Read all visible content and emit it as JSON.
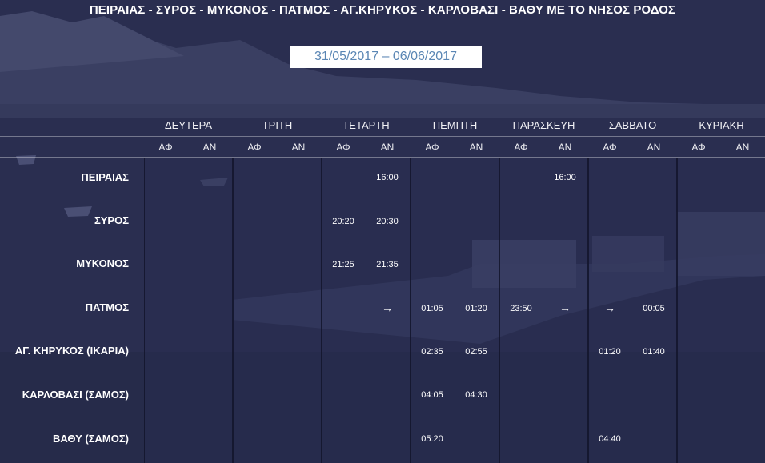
{
  "header": {
    "title": "ΠΕΙΡΑΙΑΣ - ΣΥΡΟΣ - ΜΥΚΟΝΟΣ - ΠΑΤΜΟΣ - ΑΓ.ΚΗΡΥΚΟΣ - ΚΑΡΛΟΒΑΣΙ - ΒΑΘΥ ΜΕ ΤΟ ΝΗΣΟΣ ΡΟΔΟΣ",
    "date_range": "31/05/2017 – 06/06/2017"
  },
  "days": [
    "ΔΕΥΤΕΡΑ",
    "ΤΡΙΤΗ",
    "ΤΕΤΑΡΤΗ",
    "ΠΕΜΠΤΗ",
    "ΠΑΡΑΣΚΕΥΗ",
    "ΣΑΒΒΑΤΟ",
    "ΚΥΡΙΑΚΗ"
  ],
  "sub_headers": {
    "departure": "ΑΦ",
    "arrival": "ΑΝ"
  },
  "ports": [
    "ΠΕΙΡΑΙΑΣ",
    "ΣΥΡΟΣ",
    "ΜΥΚΟΝΟΣ",
    "ΠΑΤΜΟΣ",
    "ΑΓ. ΚΗΡΥΚΟΣ (ΙΚΑΡΙΑ)",
    "ΚΑΡΛΟΒΑΣΙ (ΣΑΜΟΣ)",
    "ΒΑΘΥ (ΣΑΜΟΣ)"
  ],
  "schedule": [
    [
      "",
      "",
      "",
      "",
      "",
      "16:00",
      "",
      "",
      "",
      "16:00",
      "",
      "",
      "",
      ""
    ],
    [
      "",
      "",
      "",
      "",
      "20:20",
      "20:30",
      "",
      "",
      "",
      "",
      "",
      "",
      "",
      ""
    ],
    [
      "",
      "",
      "",
      "",
      "21:25",
      "21:35",
      "",
      "",
      "",
      "",
      "",
      "",
      "",
      ""
    ],
    [
      "",
      "",
      "",
      "",
      "",
      "→",
      "01:05",
      "01:20",
      "23:50",
      "→",
      "→",
      "00:05",
      "",
      ""
    ],
    [
      "",
      "",
      "",
      "",
      "",
      "",
      "02:35",
      "02:55",
      "",
      "",
      "01:20",
      "01:40",
      "",
      ""
    ],
    [
      "",
      "",
      "",
      "",
      "",
      "",
      "04:05",
      "04:30",
      "",
      "",
      "",
      "",
      "",
      ""
    ],
    [
      "",
      "",
      "",
      "",
      "",
      "",
      "05:20",
      "",
      "",
      "",
      "04:40",
      "",
      "",
      ""
    ]
  ]
}
